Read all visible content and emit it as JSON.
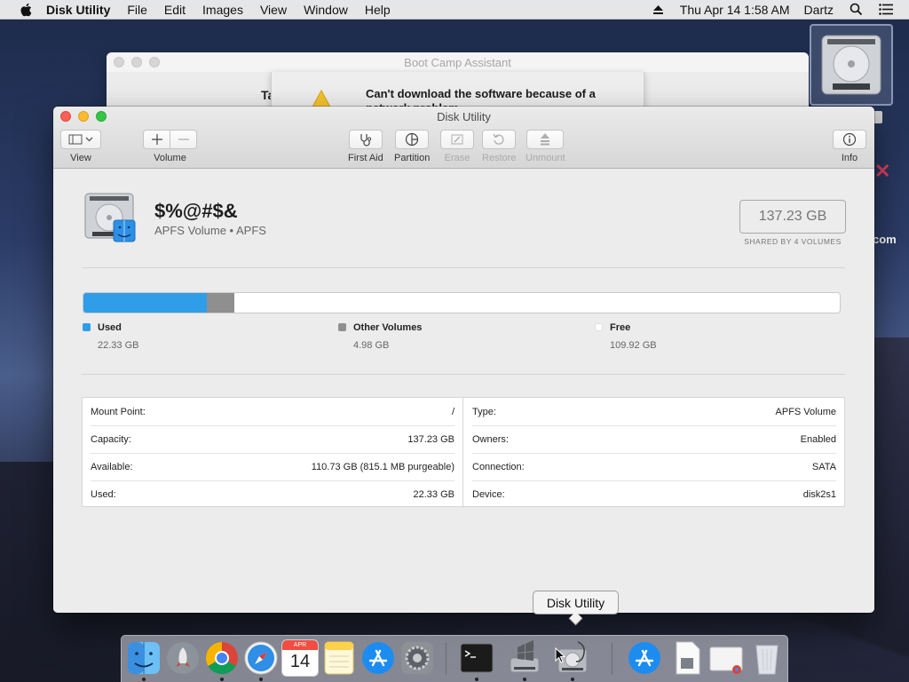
{
  "menubar": {
    "app_name": "Disk Utility",
    "items": [
      "File",
      "Edit",
      "Images",
      "View",
      "Window",
      "Help"
    ],
    "clock": "Thu Apr 14  1:58 AM",
    "user": "Dartz",
    "icons": [
      "apple-icon",
      "eject-icon",
      "spotlight-icon",
      "notification-center-icon"
    ]
  },
  "bootcamp": {
    "title": "Boot Camp Assistant",
    "partial_text": "Ta",
    "alert_message": "Can't download the software because of a network problem."
  },
  "desktop": {
    "label_fragment": "com"
  },
  "disk_utility": {
    "title": "Disk Utility",
    "toolbar": {
      "view_label": "View",
      "volume_label": "Volume",
      "first_aid_label": "First Aid",
      "partition_label": "Partition",
      "erase_label": "Erase",
      "restore_label": "Restore",
      "unmount_label": "Unmount",
      "info_label": "Info"
    },
    "volume": {
      "name": "$%@#$&",
      "subtitle": "APFS Volume • APFS",
      "size": "137.23 GB",
      "shared_note": "SHARED BY 4 VOLUMES"
    },
    "usage": {
      "used_fraction": 0.1627,
      "other_fraction": 0.0363,
      "legend": [
        {
          "name": "Used",
          "value": "22.33 GB",
          "color": "#2f9de8"
        },
        {
          "name": "Other Volumes",
          "value": "4.98 GB",
          "color": "#8f8f8f"
        },
        {
          "name": "Free",
          "value": "109.92 GB",
          "color": "#ffffff"
        }
      ]
    },
    "info": {
      "left": [
        {
          "key": "Mount Point:",
          "value": "/"
        },
        {
          "key": "Capacity:",
          "value": "137.23 GB"
        },
        {
          "key": "Available:",
          "value": "110.73 GB (815.1 MB purgeable)"
        },
        {
          "key": "Used:",
          "value": "22.33 GB"
        }
      ],
      "right": [
        {
          "key": "Type:",
          "value": "APFS Volume"
        },
        {
          "key": "Owners:",
          "value": "Enabled"
        },
        {
          "key": "Connection:",
          "value": "SATA"
        },
        {
          "key": "Device:",
          "value": "disk2s1"
        }
      ]
    }
  },
  "dock": {
    "tooltip": "Disk Utility",
    "items": [
      {
        "name": "finder",
        "running": true
      },
      {
        "name": "launchpad",
        "running": false
      },
      {
        "name": "chrome",
        "running": true
      },
      {
        "name": "safari",
        "running": true
      },
      {
        "name": "calendar",
        "running": false,
        "month": "APR",
        "day": "14"
      },
      {
        "name": "notes",
        "running": false
      },
      {
        "name": "app-store",
        "running": false
      },
      {
        "name": "system-preferences",
        "running": false
      },
      {
        "name": "terminal",
        "running": true
      },
      {
        "name": "boot-camp-assistant",
        "running": true
      },
      {
        "name": "disk-utility",
        "running": true
      },
      {
        "name": "app-store-downloads",
        "running": false
      },
      {
        "name": "document",
        "running": false
      },
      {
        "name": "chrome-document",
        "running": false
      },
      {
        "name": "trash",
        "running": false
      }
    ]
  }
}
